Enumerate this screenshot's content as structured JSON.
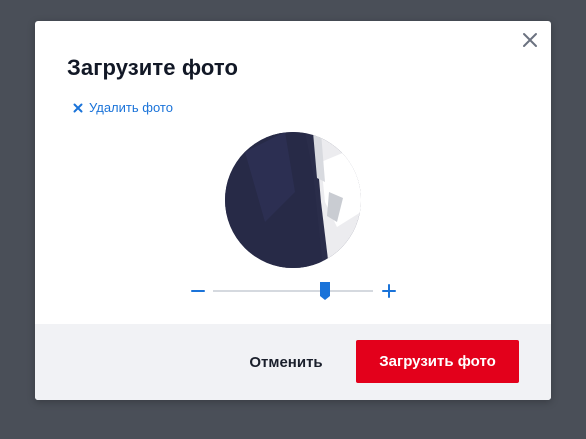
{
  "modal": {
    "title": "Загрузите фото",
    "delete_link_label": "Удалить фото",
    "zoom": {
      "value": 0.7
    },
    "footer": {
      "cancel_label": "Отменить",
      "upload_label": "Загрузить фото"
    }
  },
  "icons": {
    "close": "close-icon",
    "delete": "close-icon",
    "zoom_out": "minus-icon",
    "zoom_in": "plus-icon",
    "zoom_thumb": "slider-thumb-icon"
  },
  "colors": {
    "overlay": "#4a4f58",
    "accent_blue": "#1a73d9",
    "primary_red": "#e3001b",
    "footer_bg": "#f1f2f5",
    "title": "#121826"
  }
}
